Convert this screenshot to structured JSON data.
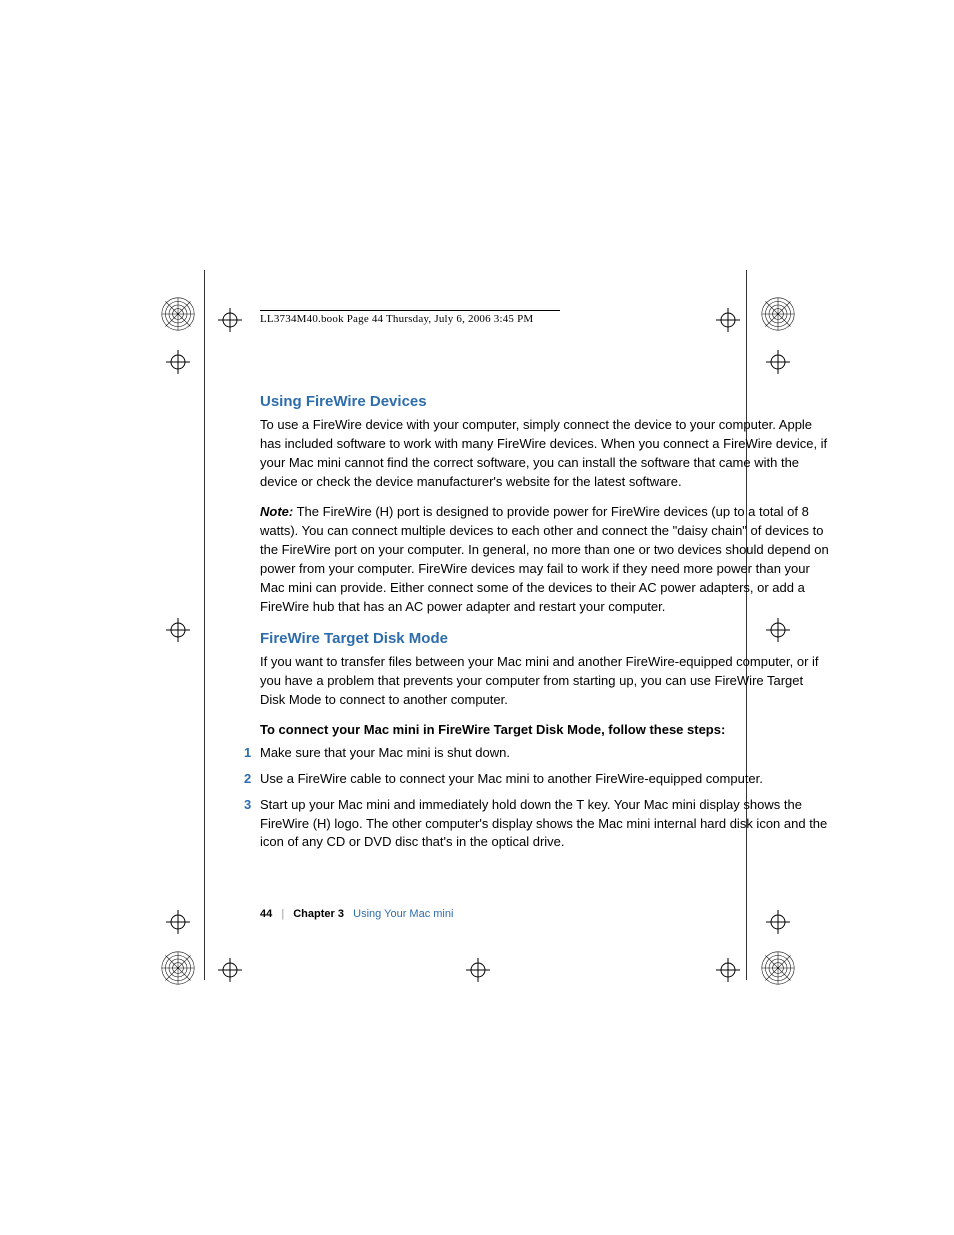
{
  "header": {
    "running_head": "LL3734M40.book  Page 44  Thursday, July 6, 2006  3:45 PM"
  },
  "sections": {
    "using_firewire_devices": {
      "heading": "Using FireWire Devices",
      "body": "To use a FireWire device with your computer, simply connect the device to your computer. Apple has included software to work with many FireWire devices. When you connect a FireWire device, if your Mac mini cannot find the correct software, you can install the software that came with the device or check the device manufacturer's website for the latest software.",
      "note_label": "Note:",
      "note_body": "The FireWire (H) port is designed to provide power for FireWire devices (up to a total of 8 watts). You can connect multiple devices to each other and connect the \"daisy chain\" of devices to the FireWire port on your computer. In general, no more than one or two devices should depend on power from your computer. FireWire devices may fail to work if they need more power than your Mac mini can provide. Either connect some of the devices to their AC power adapters, or add a FireWire hub that has an AC power adapter and restart your computer."
    },
    "target_disk_mode": {
      "heading": "FireWire Target Disk Mode",
      "body": "If you want to transfer files between your Mac mini and another FireWire-equipped computer, or if you have a problem that prevents your computer from starting up, you can use FireWire Target Disk Mode to connect to another computer.",
      "steps_intro": "To connect your Mac mini in FireWire Target Disk Mode, follow these steps:",
      "steps": [
        "Make sure that your Mac mini is shut down.",
        "Use a FireWire cable to connect your Mac mini to another FireWire-equipped computer.",
        "Start up your Mac mini and immediately hold down the T key. Your Mac mini display shows the FireWire (H) logo. The other computer's display shows the Mac mini internal hard disk icon and the icon of any CD or DVD disc that's in the optical drive."
      ]
    }
  },
  "footer": {
    "page_number": "44",
    "chapter_label": "Chapter 3",
    "chapter_title": "Using Your Mac mini"
  }
}
